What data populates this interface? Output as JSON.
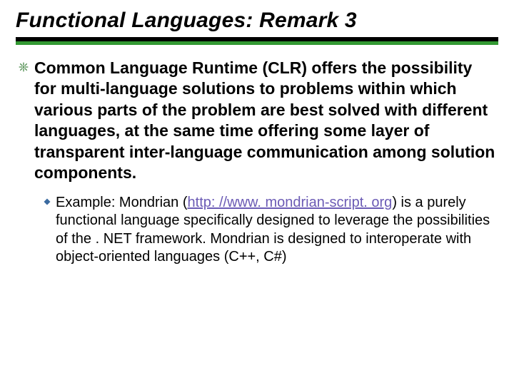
{
  "title": "Functional Languages: Remark 3",
  "bullet": {
    "text": "Common Language Runtime (CLR) offers the possibility for multi-language solutions to problems within which various parts of the problem are best solved with different languages, at the same time offering some layer of transparent inter-language communication among solution components."
  },
  "sub": {
    "prefix": "Example: Mondrian (",
    "link": "http: //www. mondrian-script. org",
    "suffix": ") is a purely functional language specifically designed to leverage the possibilities of the . NET framework. Mondrian is designed to interoperate with object-oriented languages (C++, C#)"
  }
}
